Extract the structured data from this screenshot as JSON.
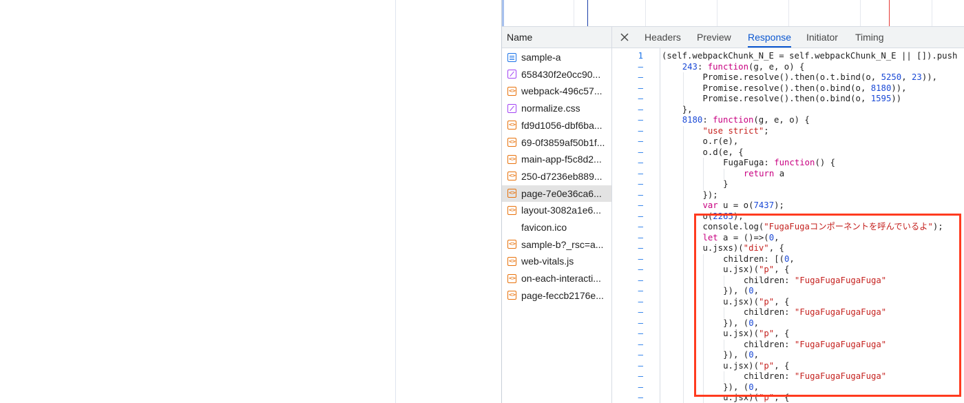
{
  "devtools": {
    "name_header": "Name",
    "tabs": [
      "Headers",
      "Preview",
      "Response",
      "Initiator",
      "Timing"
    ],
    "active_tab": "Response",
    "files": [
      {
        "name": "sample-a",
        "icon": "doc-icon",
        "selected": false
      },
      {
        "name": "658430f2e0cc90...",
        "icon": "css-icon",
        "selected": false
      },
      {
        "name": "webpack-496c57...",
        "icon": "script-icon",
        "selected": false
      },
      {
        "name": "normalize.css",
        "icon": "css-icon",
        "selected": false
      },
      {
        "name": "fd9d1056-dbf6ba...",
        "icon": "script-icon",
        "selected": false
      },
      {
        "name": "69-0f3859af50b1f...",
        "icon": "script-icon",
        "selected": false
      },
      {
        "name": "main-app-f5c8d2...",
        "icon": "script-icon",
        "selected": false
      },
      {
        "name": "250-d7236eb889...",
        "icon": "script-icon",
        "selected": false
      },
      {
        "name": "page-7e0e36ca6...",
        "icon": "script-icon",
        "selected": true
      },
      {
        "name": "layout-3082a1e6...",
        "icon": "script-icon",
        "selected": false
      },
      {
        "name": "favicon.ico",
        "icon": "blank-icon",
        "selected": false
      },
      {
        "name": "sample-b?_rsc=a...",
        "icon": "script-icon",
        "selected": false
      },
      {
        "name": "web-vitals.js",
        "icon": "script-icon",
        "selected": false
      },
      {
        "name": "on-each-interacti...",
        "icon": "script-icon",
        "selected": false
      },
      {
        "name": "page-feccb2176e...",
        "icon": "script-icon",
        "selected": false
      }
    ],
    "code_lines": [
      {
        "ln": "1",
        "indent": 0,
        "tokens": [
          [
            "p",
            "(self.webpackChunk_N_E = self.webpackChunk_N_E || []).push"
          ]
        ]
      },
      {
        "ln": "–",
        "indent": 1,
        "tokens": [
          [
            "n",
            "243"
          ],
          [
            "p",
            ": "
          ],
          [
            "k",
            "function"
          ],
          [
            "p",
            "(g, e, o) {"
          ]
        ]
      },
      {
        "ln": "–",
        "indent": 2,
        "tokens": [
          [
            "p",
            "Promise.resolve().then(o.t.bind(o, "
          ],
          [
            "n",
            "5250"
          ],
          [
            "p",
            ", "
          ],
          [
            "n",
            "23"
          ],
          [
            "p",
            ")),"
          ]
        ]
      },
      {
        "ln": "–",
        "indent": 2,
        "tokens": [
          [
            "p",
            "Promise.resolve().then(o.bind(o, "
          ],
          [
            "n",
            "8180"
          ],
          [
            "p",
            ")),"
          ]
        ]
      },
      {
        "ln": "–",
        "indent": 2,
        "tokens": [
          [
            "p",
            "Promise.resolve().then(o.bind(o, "
          ],
          [
            "n",
            "1595"
          ],
          [
            "p",
            "))"
          ]
        ]
      },
      {
        "ln": "–",
        "indent": 1,
        "tokens": [
          [
            "p",
            "},"
          ]
        ]
      },
      {
        "ln": "–",
        "indent": 1,
        "tokens": [
          [
            "n",
            "8180"
          ],
          [
            "p",
            ": "
          ],
          [
            "k",
            "function"
          ],
          [
            "p",
            "(g, e, o) {"
          ]
        ]
      },
      {
        "ln": "–",
        "indent": 2,
        "tokens": [
          [
            "s",
            "\"use strict\""
          ],
          [
            "p",
            ";"
          ]
        ]
      },
      {
        "ln": "–",
        "indent": 2,
        "tokens": [
          [
            "p",
            "o.r(e),"
          ]
        ]
      },
      {
        "ln": "–",
        "indent": 2,
        "tokens": [
          [
            "p",
            "o.d(e, {"
          ]
        ]
      },
      {
        "ln": "–",
        "indent": 3,
        "tokens": [
          [
            "p",
            "FugaFuga: "
          ],
          [
            "k",
            "function"
          ],
          [
            "p",
            "() {"
          ]
        ]
      },
      {
        "ln": "–",
        "indent": 4,
        "tokens": [
          [
            "k",
            "return"
          ],
          [
            "p",
            " a"
          ]
        ]
      },
      {
        "ln": "–",
        "indent": 3,
        "tokens": [
          [
            "p",
            "}"
          ]
        ]
      },
      {
        "ln": "–",
        "indent": 2,
        "tokens": [
          [
            "p",
            "});"
          ]
        ]
      },
      {
        "ln": "–",
        "indent": 2,
        "tokens": [
          [
            "k",
            "var"
          ],
          [
            "p",
            " u = o("
          ],
          [
            "n",
            "7437"
          ],
          [
            "p",
            ");"
          ]
        ]
      },
      {
        "ln": "–",
        "indent": 2,
        "tokens": [
          [
            "p",
            "o("
          ],
          [
            "n",
            "2265"
          ],
          [
            "p",
            "),"
          ]
        ]
      },
      {
        "ln": "–",
        "indent": 2,
        "tokens": [
          [
            "p",
            "console.log("
          ],
          [
            "s",
            "\"FugaFugaコンポーネントを呼んでいるよ\""
          ],
          [
            "p",
            ");"
          ]
        ]
      },
      {
        "ln": "–",
        "indent": 2,
        "tokens": [
          [
            "k",
            "let"
          ],
          [
            "p",
            " a = ()=>("
          ],
          [
            "n",
            "0"
          ],
          [
            "p",
            ","
          ]
        ]
      },
      {
        "ln": "–",
        "indent": 2,
        "tokens": [
          [
            "p",
            "u.jsxs)("
          ],
          [
            "s",
            "\"div\""
          ],
          [
            "p",
            ", {"
          ]
        ]
      },
      {
        "ln": "–",
        "indent": 3,
        "tokens": [
          [
            "p",
            "children: [("
          ],
          [
            "n",
            "0"
          ],
          [
            "p",
            ","
          ]
        ]
      },
      {
        "ln": "–",
        "indent": 3,
        "tokens": [
          [
            "p",
            "u.jsx)("
          ],
          [
            "s",
            "\"p\""
          ],
          [
            "p",
            ", {"
          ]
        ]
      },
      {
        "ln": "–",
        "indent": 4,
        "tokens": [
          [
            "p",
            "children: "
          ],
          [
            "s",
            "\"FugaFugaFugaFuga\""
          ]
        ]
      },
      {
        "ln": "–",
        "indent": 3,
        "tokens": [
          [
            "p",
            "}), ("
          ],
          [
            "n",
            "0"
          ],
          [
            "p",
            ","
          ]
        ]
      },
      {
        "ln": "–",
        "indent": 3,
        "tokens": [
          [
            "p",
            "u.jsx)("
          ],
          [
            "s",
            "\"p\""
          ],
          [
            "p",
            ", {"
          ]
        ]
      },
      {
        "ln": "–",
        "indent": 4,
        "tokens": [
          [
            "p",
            "children: "
          ],
          [
            "s",
            "\"FugaFugaFugaFuga\""
          ]
        ]
      },
      {
        "ln": "–",
        "indent": 3,
        "tokens": [
          [
            "p",
            "}), ("
          ],
          [
            "n",
            "0"
          ],
          [
            "p",
            ","
          ]
        ]
      },
      {
        "ln": "–",
        "indent": 3,
        "tokens": [
          [
            "p",
            "u.jsx)("
          ],
          [
            "s",
            "\"p\""
          ],
          [
            "p",
            ", {"
          ]
        ]
      },
      {
        "ln": "–",
        "indent": 4,
        "tokens": [
          [
            "p",
            "children: "
          ],
          [
            "s",
            "\"FugaFugaFugaFuga\""
          ]
        ]
      },
      {
        "ln": "–",
        "indent": 3,
        "tokens": [
          [
            "p",
            "}), ("
          ],
          [
            "n",
            "0"
          ],
          [
            "p",
            ","
          ]
        ]
      },
      {
        "ln": "–",
        "indent": 3,
        "tokens": [
          [
            "p",
            "u.jsx)("
          ],
          [
            "s",
            "\"p\""
          ],
          [
            "p",
            ", {"
          ]
        ]
      },
      {
        "ln": "–",
        "indent": 4,
        "tokens": [
          [
            "p",
            "children: "
          ],
          [
            "s",
            "\"FugaFugaFugaFuga\""
          ]
        ]
      },
      {
        "ln": "–",
        "indent": 3,
        "tokens": [
          [
            "p",
            "}), ("
          ],
          [
            "n",
            "0"
          ],
          [
            "p",
            ","
          ]
        ]
      },
      {
        "ln": "–",
        "indent": 3,
        "tokens": [
          [
            "p",
            "u.jsx)("
          ],
          [
            "s",
            "\"p\""
          ],
          [
            "p",
            ", {"
          ]
        ]
      }
    ]
  },
  "colors": {
    "accent": "#0b57d0",
    "highlight_border": "#ff3b1f",
    "keyword": "#c80080",
    "number": "#1a49d6",
    "string": "#c5221f"
  }
}
